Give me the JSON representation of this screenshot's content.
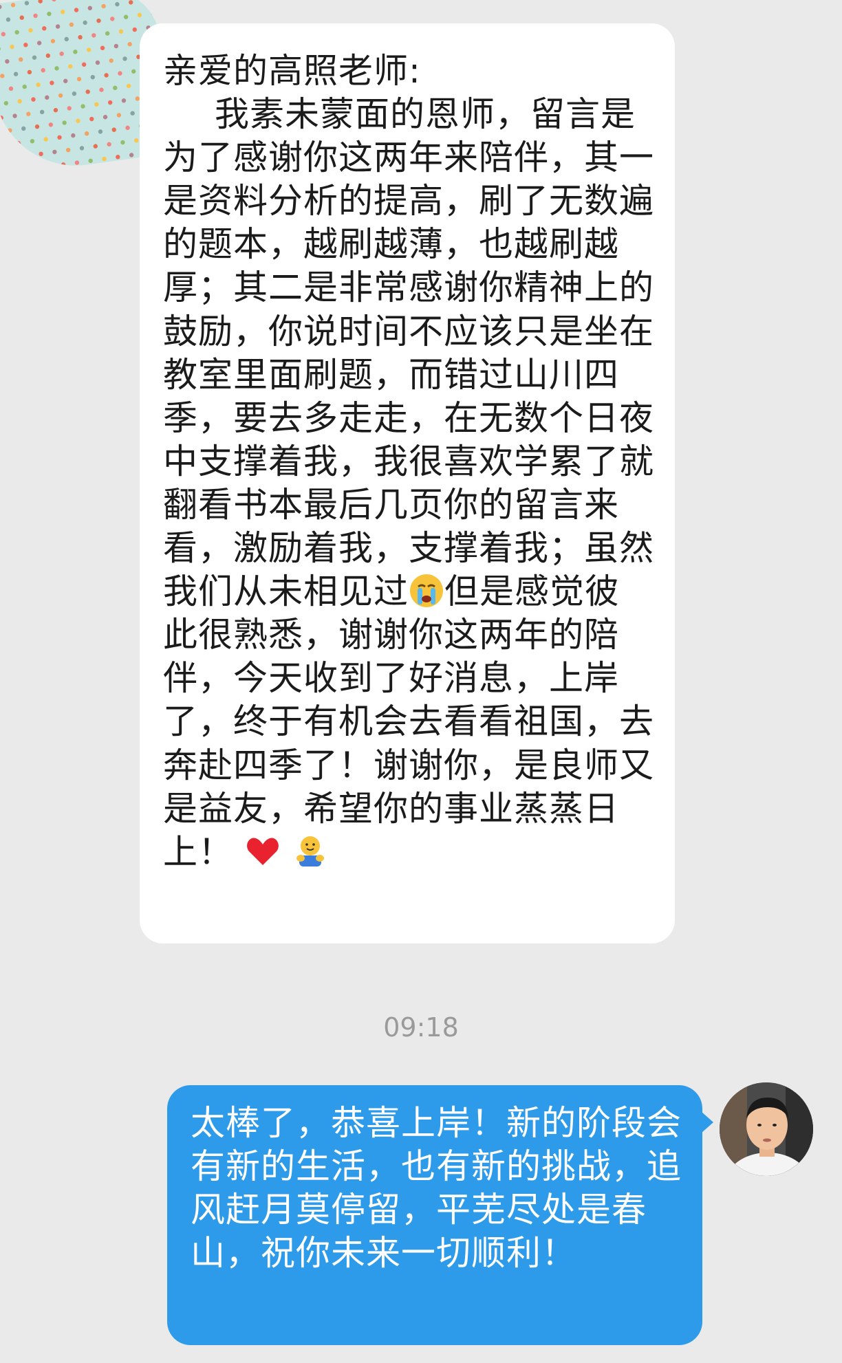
{
  "conversation": {
    "incoming": {
      "greeting": "亲爱的高照老师:",
      "body_part1": "我素未蒙面的恩师，留言是为了感谢你这两年来陪伴，其一是资料分析的提高，刷了无数遍的题本，越刷越薄，也越刷越厚；其二是非常感谢你精神上的鼓励，你说时间不应该只是坐在教室里面刷题，而错过山川四季，要去多走走，在无数个日夜中支撑着我，我很喜欢学累了就翻看书本最后几页你的留言来看，激励着我，支撑着我；虽然我们从未相见过",
      "body_part2": "但是感觉彼此很熟悉，谢谢你这两年的陪伴，今天收到了好消息，上岸了，终于有机会去看看祖国，去奔赴四季了！谢谢你，是良师又是益友，希望你的事业蒸蒸日上！ ",
      "emojis": [
        "crying-emoji",
        "heart-emoji",
        "hug-emoji"
      ]
    },
    "timestamp": "09:18",
    "outgoing": {
      "body": "太棒了，恭喜上岸！新的阶段会有新的生活，也有新的挑战，追风赶月莫停留，平芜尽处是春山，祝你未来一切顺利！"
    }
  },
  "colors": {
    "background": "#eaeaea",
    "incoming_bubble": "#ffffff",
    "outgoing_bubble": "#2e9bea",
    "timestamp_text": "#9a9a9a"
  }
}
